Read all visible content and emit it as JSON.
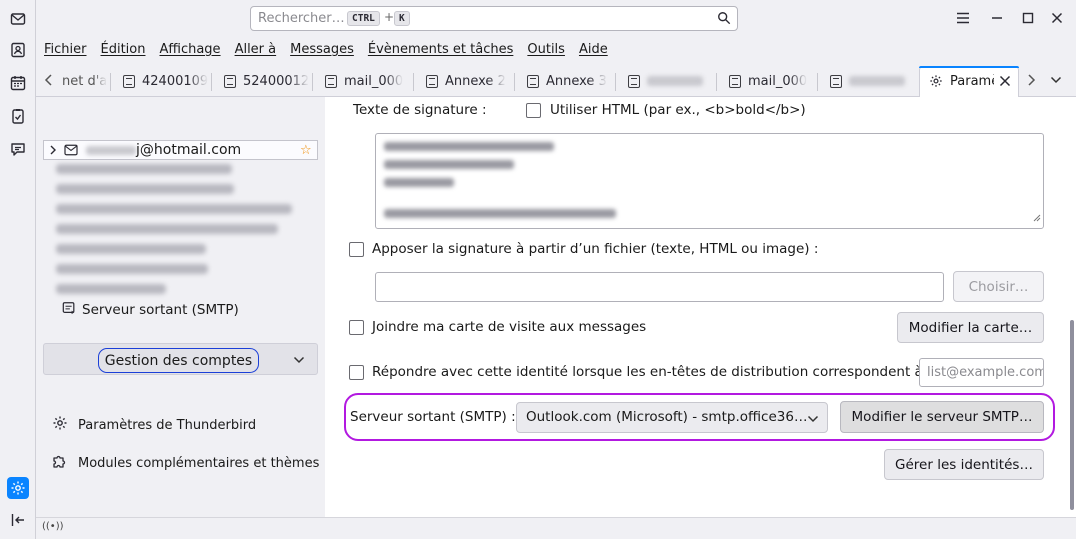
{
  "search": {
    "placeholder": "Rechercher…",
    "key1": "CTRL",
    "plus": "+",
    "key2": "K"
  },
  "menu": [
    "Fichier",
    "Édition",
    "Affichage",
    "Aller à",
    "Messages",
    "Évènements et tâches",
    "Outils",
    "Aide"
  ],
  "tabs": [
    {
      "label": "net d'a"
    },
    {
      "label": "42400109"
    },
    {
      "label": "52400012"
    },
    {
      "label": "mail_000"
    },
    {
      "label": "Annexe 2"
    },
    {
      "label": "Annexe 3"
    },
    {
      "label": ""
    },
    {
      "label": "mail_000"
    },
    {
      "label": ""
    },
    {
      "label": "Paramètres",
      "active": true
    }
  ],
  "sidebar": {
    "selected_account": "j@hotmail.com",
    "smtp_label": "Serveur sortant (SMTP)",
    "account_management": "Gestion des comptes",
    "settings_link": "Paramètres de Thunderbird",
    "addons_link": "Modules complémentaires et thèmes"
  },
  "form": {
    "signature_label": "Texte de signature :",
    "use_html_label": "Utiliser HTML (par ex., <b>bold</b>)",
    "attach_file_label": "Apposer la signature à partir d’un fichier (texte, HTML ou image) :",
    "choose_button": "Choisir…",
    "vcard_label": "Joindre ma carte de visite aux messages",
    "edit_card_button": "Modifier la carte…",
    "reply_identity_label": "Répondre avec cette identité lorsque les en-têtes de distribution correspondent à :",
    "reply_placeholder": "list@example.com",
    "smtp_label": "Serveur sortant (SMTP) :",
    "smtp_value": "Outlook.com (Microsoft) - smtp.office36…",
    "edit_smtp_button": "Modifier le serveur SMTP…",
    "manage_identities_button": "Gérer les identités…"
  },
  "colors": {
    "accent": "#0a84ff",
    "highlight_purple": "#b219e0",
    "highlight_blue": "#1b3fd8",
    "star": "#f08c00"
  }
}
